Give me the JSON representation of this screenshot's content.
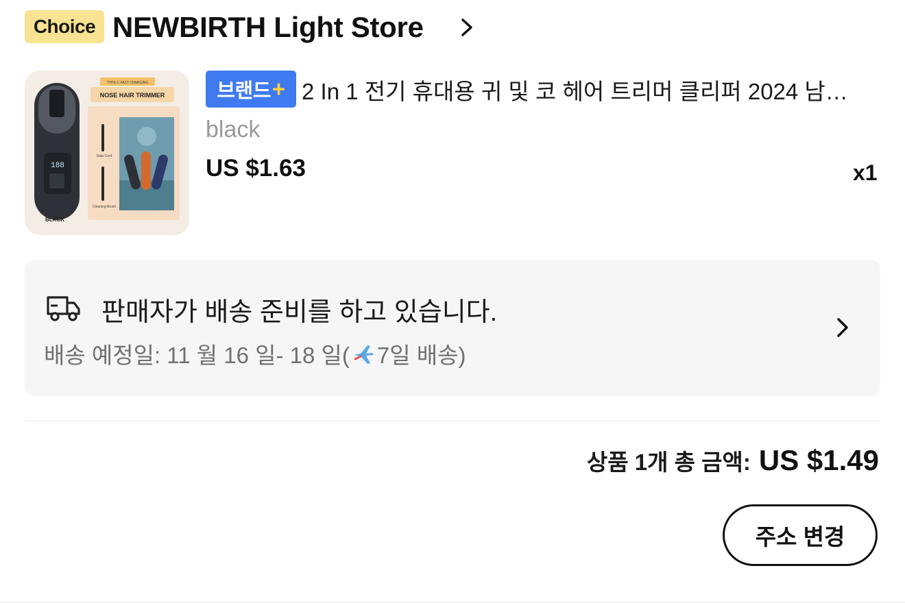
{
  "store": {
    "badge": "Choice",
    "name": "NEWBIRTH Light Store"
  },
  "product": {
    "brand_badge": "브랜드",
    "brand_badge_plus": "+",
    "title": "2 In 1 전기 휴대용 귀 및 코 헤어 트리머 클리퍼 2024 남…",
    "variant": "black",
    "price": "US $1.63",
    "quantity": "x1",
    "image": {
      "box_label_top": "TYPE-C FAST CHARGING",
      "box_label": "NOSE HAIR TRIMMER",
      "color_label": "BLACK",
      "accessory_1": "Data Cord",
      "accessory_2": "Cleaning Brush",
      "display_digits": "188"
    }
  },
  "shipping": {
    "status": "판매자가 배송 준비를 하고 있습니다.",
    "date_prefix": "배송 예정일: 11 월 16 일- 18 일(",
    "date_suffix": "7일 배송)"
  },
  "summary": {
    "total_label": "상품 1개 총 금액:",
    "total_value": "US $1.49"
  },
  "actions": {
    "change_address": "주소 변경"
  },
  "colors": {
    "choice_badge": "#f7e391",
    "brand_badge": "#3f7af0",
    "brand_plus": "#f9cf3f",
    "shipping_box": "#f6f6f6"
  }
}
